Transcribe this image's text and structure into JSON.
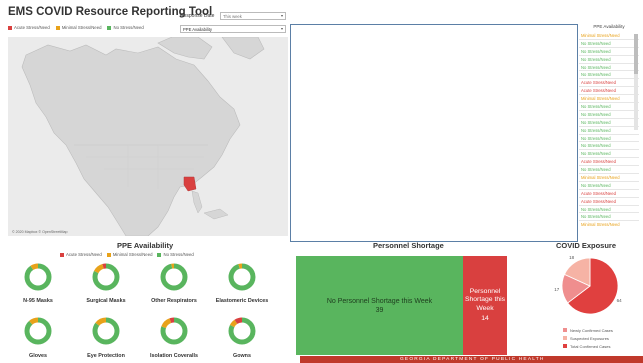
{
  "header": {
    "title": "EMS COVID Resource Reporting Tool",
    "response_date_label": "Response Date",
    "response_date_value": "This week",
    "ppe_filter_value": "PPE Availability"
  },
  "legend": [
    {
      "label": "Acute Stress/Need",
      "color": "#d9403f"
    },
    {
      "label": "Minimal Stress/Need",
      "color": "#e8a21a"
    },
    {
      "label": "No Stress/Need",
      "color": "#59b55e"
    }
  ],
  "map": {
    "attribution": "© 2020 Mapbox © OpenStreetMap",
    "highlight_color": "#d9403f"
  },
  "ppe_availability_list": {
    "header": "PPE Availability",
    "rows": [
      {
        "label": "Minimal Stress/Need",
        "status": "minimal"
      },
      {
        "label": "No Stress/Need",
        "status": "none"
      },
      {
        "label": "No Stress/Need",
        "status": "none"
      },
      {
        "label": "No Stress/Need",
        "status": "none"
      },
      {
        "label": "No Stress/Need",
        "status": "none"
      },
      {
        "label": "No Stress/Need",
        "status": "none"
      },
      {
        "label": "Acute Stress/Need",
        "status": "acute"
      },
      {
        "label": "Acute Stress/Need",
        "status": "acute"
      },
      {
        "label": "Minimal Stress/Need",
        "status": "minimal"
      },
      {
        "label": "No Stress/Need",
        "status": "none"
      },
      {
        "label": "No Stress/Need",
        "status": "none"
      },
      {
        "label": "No Stress/Need",
        "status": "none"
      },
      {
        "label": "No Stress/Need",
        "status": "none"
      },
      {
        "label": "No Stress/Need",
        "status": "none"
      },
      {
        "label": "No Stress/Need",
        "status": "none"
      },
      {
        "label": "No Stress/Need",
        "status": "none"
      },
      {
        "label": "Acute Stress/Need",
        "status": "acute"
      },
      {
        "label": "No Stress/Need",
        "status": "none"
      },
      {
        "label": "Minimal Stress/Need",
        "status": "minimal"
      },
      {
        "label": "No Stress/Need",
        "status": "none"
      },
      {
        "label": "Acute Stress/Need",
        "status": "acute"
      },
      {
        "label": "Acute Stress/Need",
        "status": "acute"
      },
      {
        "label": "No Stress/Need",
        "status": "none"
      },
      {
        "label": "No Stress/Need",
        "status": "none"
      },
      {
        "label": "Minimal Stress/Need",
        "status": "minimal"
      },
      {
        "label": "Minimal Stress/Need",
        "status": "minimal"
      }
    ]
  },
  "ppe_section": {
    "title": "PPE Availability",
    "items": [
      {
        "label": "N-95 Masks",
        "none": 0.9,
        "minimal": 0.1,
        "acute": 0.0
      },
      {
        "label": "Surgical Masks",
        "none": 0.82,
        "minimal": 0.13,
        "acute": 0.05
      },
      {
        "label": "Other Respirators",
        "none": 0.96,
        "minimal": 0.04,
        "acute": 0.0
      },
      {
        "label": "Elastomeric Devices",
        "none": 0.95,
        "minimal": 0.05,
        "acute": 0.0
      },
      {
        "label": "Gloves",
        "none": 0.88,
        "minimal": 0.12,
        "acute": 0.0
      },
      {
        "label": "Eye Protection",
        "none": 0.85,
        "minimal": 0.15,
        "acute": 0.0
      },
      {
        "label": "Isolation Coveralls",
        "none": 0.8,
        "minimal": 0.14,
        "acute": 0.06
      },
      {
        "label": "Gowns",
        "none": 0.82,
        "minimal": 0.08,
        "acute": 0.1
      }
    ]
  },
  "personnel": {
    "title": "Personnel Shortage",
    "no_shortage_label": "No Personnel Shortage this Week",
    "no_shortage_value": "39",
    "shortage_label_line1": "Personnel",
    "shortage_label_line2": "Shortage this",
    "shortage_label_line3": "Week",
    "shortage_value": "14"
  },
  "covid_exposure": {
    "title": "COVID Exposure",
    "legend": [
      {
        "label": "Newly Confirmed Cases",
        "color": "#ef8e8e"
      },
      {
        "label": "Suspected Exposures",
        "color": "#f6b3a5"
      },
      {
        "label": "Total Confirmed Cases",
        "color": "#e0403f"
      }
    ]
  },
  "chart_data": {
    "type": "pie",
    "title": "COVID Exposure",
    "slices": [
      {
        "label": "Total Confirmed Cases",
        "value": 64,
        "color": "#e0403f"
      },
      {
        "label": "Newly Confirmed Cases",
        "value": 17,
        "color": "#ef8e8e"
      },
      {
        "label": "Suspected Exposures",
        "value": 18,
        "color": "#f6b3a5"
      }
    ]
  },
  "footer": {
    "text": "GEORGIA DEPARTMENT OF PUBLIC HEALTH"
  }
}
